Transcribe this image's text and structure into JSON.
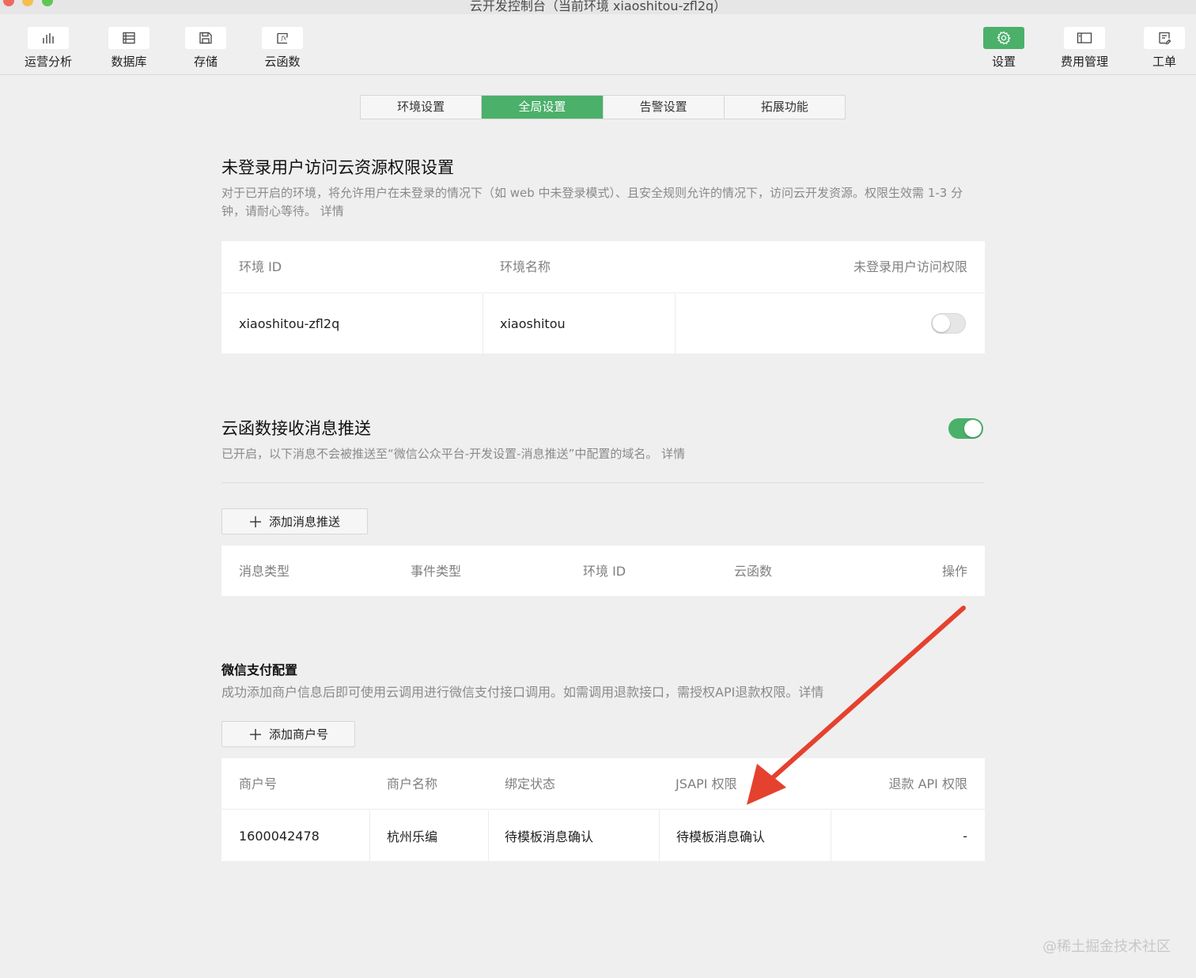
{
  "window": {
    "title": "云开发控制台（当前环境 xiaoshitou-zfl2q）"
  },
  "toolbar": {
    "left": [
      {
        "label": "运营分析",
        "icon": "bar-chart-icon"
      },
      {
        "label": "数据库",
        "icon": "database-icon"
      },
      {
        "label": "存储",
        "icon": "storage-icon"
      },
      {
        "label": "云函数",
        "icon": "function-icon"
      }
    ],
    "right": [
      {
        "label": "设置",
        "icon": "gear-icon",
        "active": true
      },
      {
        "label": "费用管理",
        "icon": "billing-icon"
      },
      {
        "label": "工单",
        "icon": "ticket-icon"
      }
    ]
  },
  "tabs": [
    {
      "label": "环境设置",
      "active": false
    },
    {
      "label": "全局设置",
      "active": true
    },
    {
      "label": "告警设置",
      "active": false
    },
    {
      "label": "拓展功能",
      "active": false
    }
  ],
  "unauth": {
    "title": "未登录用户访问云资源权限设置",
    "desc": "对于已开启的环境，将允许用户在未登录的情况下（如 web 中未登录模式）、且安全规则允许的情况下，访问云开发资源。权限生效需 1-3 分钟，请耐心等待。 详情",
    "columns": [
      "环境 ID",
      "环境名称",
      "未登录用户访问权限"
    ],
    "row": {
      "env_id": "xiaoshitou-zfl2q",
      "env_name": "xiaoshitou",
      "enabled": false
    }
  },
  "push": {
    "title": "云函数接收消息推送",
    "enabled": true,
    "desc": "已开启，以下消息不会被推送至“微信公众平台-开发设置-消息推送”中配置的域名。 详情",
    "add_button": "添加消息推送",
    "columns": [
      "消息类型",
      "事件类型",
      "环境 ID",
      "云函数",
      "操作"
    ]
  },
  "wxpay": {
    "title": "微信支付配置",
    "desc": "成功添加商户信息后即可使用云调用进行微信支付接口调用。如需调用退款接口，需授权API退款权限。详情",
    "add_button": "添加商户号",
    "columns": [
      "商户号",
      "商户名称",
      "绑定状态",
      "JSAPI 权限",
      "退款 API 权限"
    ],
    "row": {
      "mch_id": "1600042478",
      "name": "杭州乐编",
      "bind_status": "待模板消息确认",
      "jsapi": "待模板消息确认",
      "refund": "-"
    }
  },
  "colors": {
    "accent": "#4ab06a",
    "annotation_arrow": "#e5412f"
  },
  "watermark": "@稀土掘金技术社区"
}
